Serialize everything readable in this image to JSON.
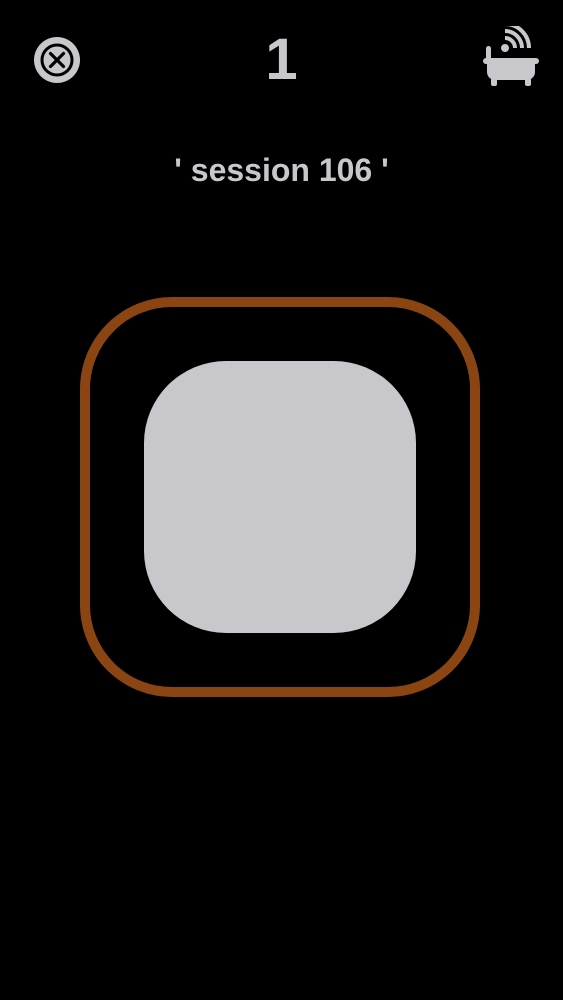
{
  "header": {
    "counter": "1",
    "close_icon": "close-icon",
    "right_icon": "bathtub-wifi-icon"
  },
  "session": {
    "label": "' session 106 '"
  },
  "colors": {
    "background": "#000000",
    "foreground": "#c8c7cc",
    "frame": "#8a4513"
  }
}
